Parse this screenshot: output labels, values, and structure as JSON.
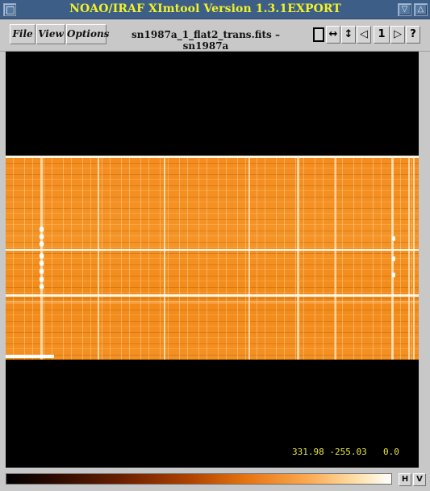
{
  "window": {
    "title": "NOAO/IRAF XImtool Version 1.3.1EXPORT",
    "buttons": {
      "minimize": "▽",
      "maximize": "△"
    }
  },
  "menu": {
    "file": "File",
    "view": "View",
    "options": "Options"
  },
  "frame": {
    "filename": "sn1987a_1_flat2_trans.fits – sn1987a"
  },
  "toolbar": {
    "frame_number": "1",
    "help": "?",
    "icons": [
      "square-frame-icon",
      "horizontal-arrows-icon",
      "vertical-arrows-icon",
      "prev-arrow-icon",
      "frame-number",
      "next-arrow-icon",
      "help-icon"
    ]
  },
  "readout": {
    "coords": "331.98  -255.03",
    "pixel_value": "0.0"
  },
  "colorbar": {
    "h_label": "H",
    "v_label": "V"
  },
  "colors": {
    "titlebar": "#3d5f87",
    "title_text": "#f2f22a",
    "image_band": "#f48c1e",
    "readout_text": "#e8e83a"
  }
}
